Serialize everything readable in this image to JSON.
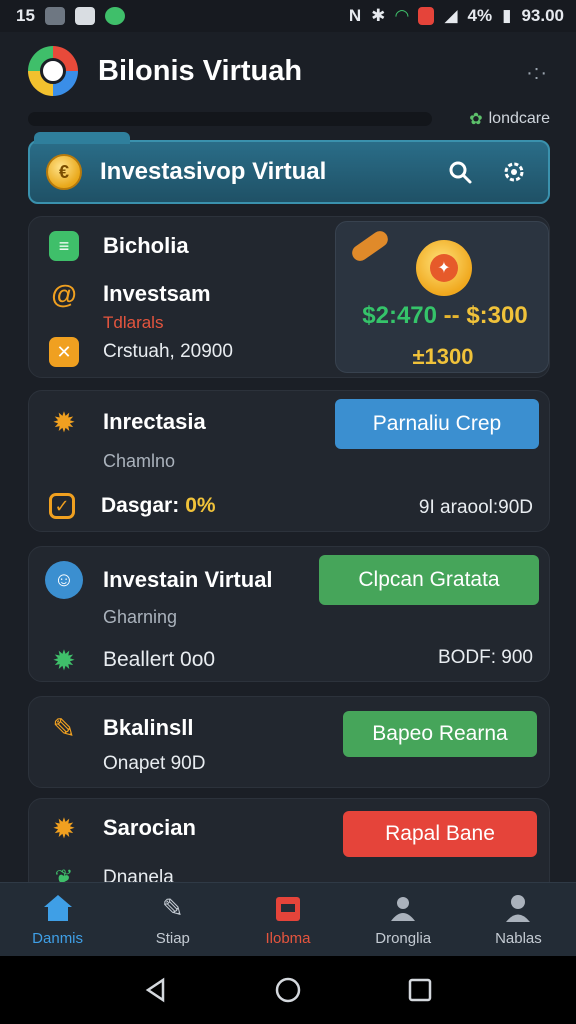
{
  "status_bar": {
    "left_text": "15",
    "network": "N",
    "battery": "4%",
    "time": "93.00"
  },
  "header": {
    "title": "Bilonis Virtuah",
    "sub_right": "londcare"
  },
  "banner": {
    "title": "Investasivop Virtual",
    "coin_glyph": "€"
  },
  "card1": {
    "items": [
      {
        "label": "Bicholia",
        "icon": "document-icon",
        "color": "#3fbf6a"
      },
      {
        "label": "Investsam",
        "icon": "swirl-icon",
        "color": "#f0a020"
      },
      {
        "label": "Crstuah, 20900",
        "icon": "tools-icon",
        "color": "#f0a020"
      }
    ],
    "red_text": "Tdlarals",
    "panel": {
      "range_low": "$2:470",
      "range_sep": " -- ",
      "range_high": "$:300",
      "amount": "±1300"
    }
  },
  "card2": {
    "title": "Inrectasia",
    "subtitle": "Chamlno",
    "row_label": "Dasgar:",
    "row_pct": "0%",
    "right_value": "9I araool:90D",
    "button": "Parnaliu Crep",
    "button_color": "#3b8fd0"
  },
  "card3": {
    "title": "Investain Virtual",
    "subtitle": "Gharning",
    "row_label": "Beallert 0o0",
    "right_value": "BODF: 900",
    "button": "Clpcan Gratata",
    "button_color": "#46a55a"
  },
  "card4": {
    "title": "Bkalinsll",
    "row_label": "Onapet 90D",
    "button": "Bapeo Rearna",
    "button_color": "#46a55a"
  },
  "card5": {
    "title": "Sarocian",
    "row_label": "Dnanela",
    "button": "Rapal Bane",
    "button_color": "#e5443a"
  },
  "bottom_nav": [
    {
      "label": "Danmis",
      "icon": "home-icon",
      "state": "active"
    },
    {
      "label": "Stiap",
      "icon": "pen-icon",
      "state": "normal"
    },
    {
      "label": "Ilobma",
      "icon": "calendar-icon",
      "state": "alert"
    },
    {
      "label": "Dronglia",
      "icon": "group-icon",
      "state": "normal"
    },
    {
      "label": "Nablas",
      "icon": "person-icon",
      "state": "normal"
    }
  ],
  "colors": {
    "background": "#1b1f26",
    "card": "#22272f",
    "accent_blue": "#3f9fe6",
    "accent_green": "#46a55a",
    "accent_red": "#e5443a",
    "gold": "#f0c23a"
  }
}
